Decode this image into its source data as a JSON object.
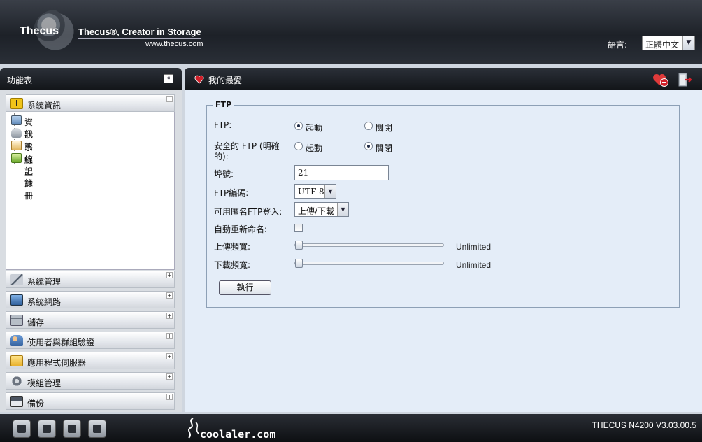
{
  "header": {
    "logo_text": "Thecus",
    "slogan": "Thecus®, Creator in Storage",
    "url": "www.thecus.com",
    "language_label": "語言:",
    "language_value": "正體中文"
  },
  "sidebar": {
    "title": "功能表",
    "collapse_symbol": "«",
    "sections": [
      {
        "label": "系統資訊",
        "icon": "info-icon",
        "expanded": true,
        "toggle": "−",
        "items": [
          {
            "label": "資訊",
            "icon": "magnifier-icon"
          },
          {
            "label": "狀態",
            "icon": "user-status-icon"
          },
          {
            "label": "系統記錄",
            "icon": "log-icon"
          },
          {
            "label": "線上註冊",
            "icon": "register-icon"
          }
        ]
      },
      {
        "label": "系統管理",
        "icon": "tools-icon",
        "toggle": "+"
      },
      {
        "label": "系統網路",
        "icon": "network-icon",
        "toggle": "+"
      },
      {
        "label": "儲存",
        "icon": "storage-icon",
        "toggle": "+"
      },
      {
        "label": "使用者與群組驗證",
        "icon": "users-icon",
        "toggle": "+"
      },
      {
        "label": "應用程式伺服器",
        "icon": "folder-icon",
        "toggle": "+"
      },
      {
        "label": "模組管理",
        "icon": "gear-icon",
        "toggle": "+"
      },
      {
        "label": "備份",
        "icon": "backup-icon",
        "toggle": "+"
      }
    ]
  },
  "main": {
    "title": "我的最愛",
    "ftp": {
      "legend": "FTP",
      "ftp_label": "FTP:",
      "enable_label": "起動",
      "disable_label": "關閉",
      "ftp_enabled": true,
      "secure_label_line1": "安全的 FTP (明確",
      "secure_label_line2": "的):",
      "secure_enabled": false,
      "port_label": "埠號:",
      "port_value": "21",
      "encoding_label": "FTP編碼:",
      "encoding_value": "UTF-8",
      "anon_label": "可用匿名FTP登入:",
      "anon_value": "上傳/下載",
      "autorename_label": "自動重新命名:",
      "autorename_checked": false,
      "upload_label": "上傳頻寬:",
      "upload_value": "Unlimited",
      "upload_level": 0,
      "download_label": "下載頻寬:",
      "download_value": "Unlimited",
      "download_level": 0,
      "apply_label": "執行"
    }
  },
  "footer": {
    "icons": [
      "server-icon",
      "disk-icon",
      "fan-icon",
      "network-tree-icon"
    ],
    "watermark": "coolaler.com",
    "version": "THECUS N4200 V3.03.00.5"
  },
  "colors": {
    "header_bg": "#1d2128",
    "panel_bg": "#e4edf8",
    "sidebar_bg": "#d9dde2",
    "heart": "#d0202a"
  }
}
